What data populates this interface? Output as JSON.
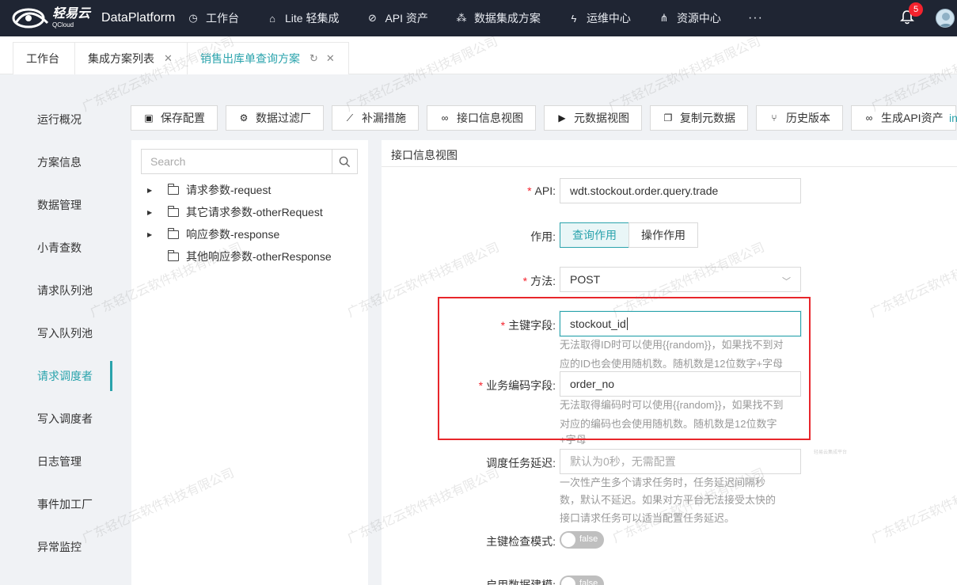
{
  "header": {
    "logo_cn": "轻易云",
    "logo_en": "QCloud",
    "app_name": "DataPlatform",
    "nav": [
      {
        "label": "工作台",
        "icon": "clock-icon"
      },
      {
        "label": "Lite 轻集成",
        "icon": "home-icon"
      },
      {
        "label": "API 资产",
        "icon": "compass-icon"
      },
      {
        "label": "数据集成方案",
        "icon": "nodes-icon"
      },
      {
        "label": "运维中心",
        "icon": "lightning-icon"
      },
      {
        "label": "资源中心",
        "icon": "cluster-icon"
      }
    ],
    "more": "···",
    "notification_count": "5"
  },
  "tabs": [
    {
      "label": "工作台"
    },
    {
      "label": "集成方案列表"
    },
    {
      "label": "销售出库单查询方案"
    }
  ],
  "sidebar": {
    "items": [
      {
        "label": "运行概况"
      },
      {
        "label": "方案信息"
      },
      {
        "label": "数据管理"
      },
      {
        "label": "小青查数"
      },
      {
        "label": "请求队列池"
      },
      {
        "label": "写入队列池"
      },
      {
        "label": "请求调度者"
      },
      {
        "label": "写入调度者"
      },
      {
        "label": "日志管理"
      },
      {
        "label": "事件加工厂"
      },
      {
        "label": "异常监控"
      }
    ],
    "active_index": 6
  },
  "toolbar": {
    "buttons": [
      {
        "label": "保存配置",
        "icon": "save-icon"
      },
      {
        "label": "数据过滤厂",
        "icon": "gear-icon"
      },
      {
        "label": "补漏措施",
        "icon": "line-chart-icon"
      },
      {
        "label": "接口信息视图",
        "icon": "link-icon"
      },
      {
        "label": "元数据视图",
        "icon": "terminal-icon"
      },
      {
        "label": "复制元数据",
        "icon": "copy-icon"
      },
      {
        "label": "历史版本",
        "icon": "branch-icon"
      },
      {
        "label": "生成API资产",
        "icon": "link-icon"
      }
    ],
    "overflow_text": "in"
  },
  "tree": {
    "search_placeholder": "Search",
    "nodes": [
      {
        "label": "请求参数-request",
        "expandable": true
      },
      {
        "label": "其它请求参数-otherRequest",
        "expandable": true
      },
      {
        "label": "响应参数-response",
        "expandable": true
      },
      {
        "label": "其他响应参数-otherResponse",
        "expandable": false
      }
    ]
  },
  "detail": {
    "title": "接口信息视图",
    "api": {
      "label": "API:",
      "value": "wdt.stockout.order.query.trade"
    },
    "effect": {
      "label": "作用:",
      "options": [
        "查询作用",
        "操作作用"
      ],
      "selected": "查询作用"
    },
    "method": {
      "label": "方法:",
      "value": "POST"
    },
    "primary_key": {
      "label": "主键字段:",
      "value": "stockout_id",
      "help_1": "无法取得ID时可以使用{{random}}，如果找不到对",
      "help_2": "应的ID也会使用随机数。随机数是12位数字+字母"
    },
    "biz_code": {
      "label": "业务编码字段:",
      "value": "order_no",
      "help_1": "无法取得编码时可以使用{{random}}，如果找不到",
      "help_2": "对应的编码也会使用随机数。随机数是12位数字",
      "help_3": "+字母"
    },
    "delay": {
      "label": "调度任务延迟:",
      "placeholder": "默认为0秒，无需配置",
      "help_1": "一次性产生多个请求任务时，任务延迟间隔秒",
      "help_2": "数，默认不延迟。如果对方平台无法接受太快的",
      "help_3": "接口请求任务可以适当配置任务延迟。"
    },
    "pk_check": {
      "label": "主键检查模式:",
      "value": "false"
    },
    "data_model": {
      "label": "启用数据建模:",
      "value": "false"
    }
  },
  "watermark": {
    "text": "广东轻亿云软件科技有限公司",
    "small_text": "轻易云集成平台"
  },
  "colors": {
    "topbar": "#1f2533",
    "accent": "#2aa3ac",
    "highlight_border": "#e8262b",
    "badge": "#f5222d"
  }
}
